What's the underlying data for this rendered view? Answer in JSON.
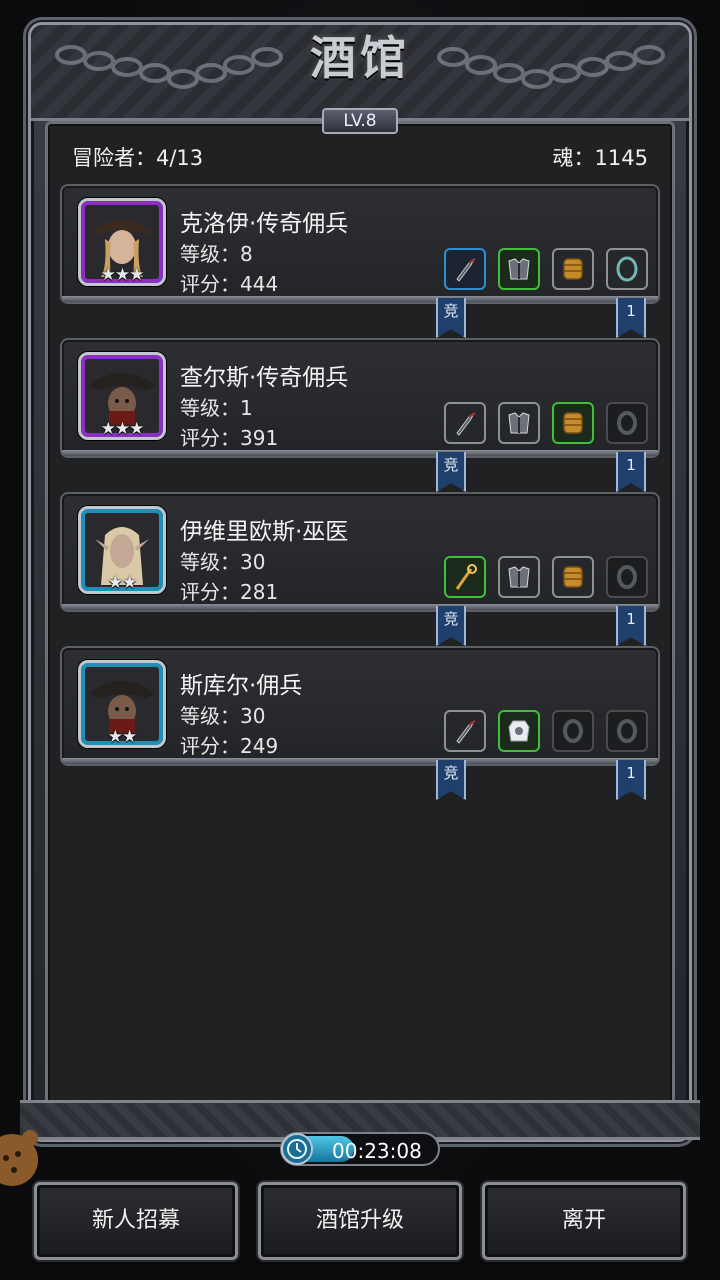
{
  "header": {
    "title": "酒馆",
    "level": "LV.8",
    "adventurers": "冒险者：4/13",
    "soul": "魂：1145"
  },
  "heroes": [
    {
      "name": "克洛伊·传奇佣兵",
      "level": "等级：8",
      "score": "评分：444",
      "stars": "★★★",
      "rarity_color": "#8a2fc0",
      "equipment": [
        "blue",
        "green",
        "plain",
        "plain"
      ],
      "badge_left": "竞",
      "badge_right": "1"
    },
    {
      "name": "查尔斯·传奇佣兵",
      "level": "等级：1",
      "score": "评分：391",
      "stars": "★★★",
      "rarity_color": "#8a2fc0",
      "equipment": [
        "plain",
        "plain",
        "green",
        "empty"
      ],
      "badge_left": "竞",
      "badge_right": "1"
    },
    {
      "name": "伊维里欧斯·巫医",
      "level": "等级：30",
      "score": "评分：281",
      "stars": "★★",
      "rarity_color": "#1f8fb5",
      "equipment": [
        "green",
        "plain",
        "plain",
        "empty"
      ],
      "badge_left": "竞",
      "badge_right": "1"
    },
    {
      "name": "斯库尔·佣兵",
      "level": "等级：30",
      "score": "评分：249",
      "stars": "★★",
      "rarity_color": "#1f8fb5",
      "equipment": [
        "plain",
        "green",
        "empty",
        "empty"
      ],
      "badge_left": "竞",
      "badge_right": "1"
    }
  ],
  "timer": {
    "value": "00:23:08"
  },
  "buttons": {
    "recruit": "新人招募",
    "upgrade": "酒馆升级",
    "leave": "离开"
  }
}
